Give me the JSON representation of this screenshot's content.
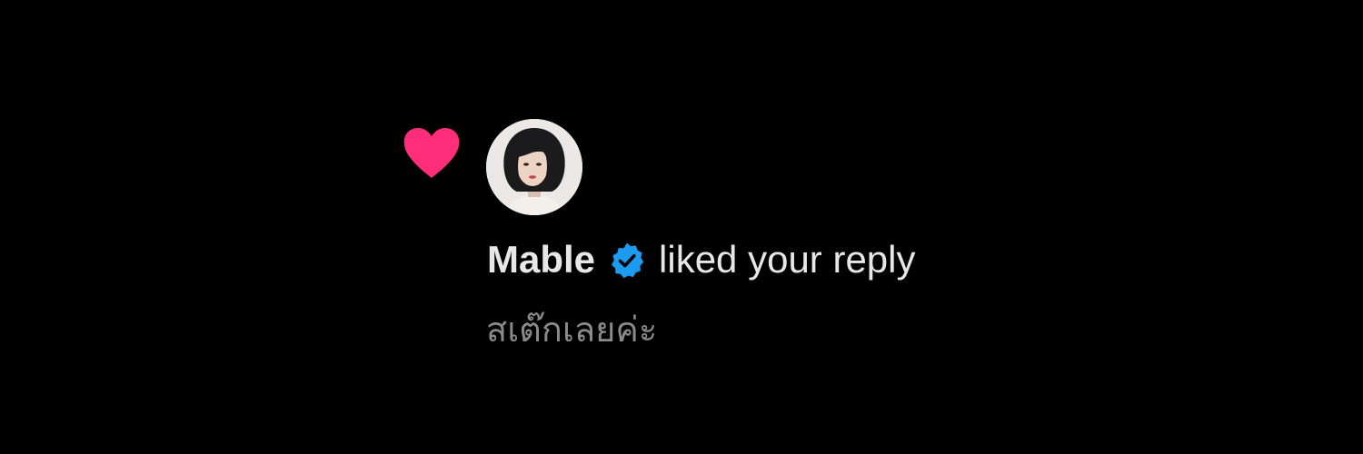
{
  "notification": {
    "username": "Mable",
    "action": "liked your reply",
    "reply_excerpt": "สเต๊กเลยค่ะ",
    "icons": {
      "reaction": "heart-icon",
      "badge": "verified-badge-icon"
    },
    "colors": {
      "background": "#000000",
      "heart": "#ff2d7a",
      "verified": "#1d9bf0",
      "primary_text": "#e7e7e7",
      "secondary_text": "#8a8a8a"
    }
  }
}
